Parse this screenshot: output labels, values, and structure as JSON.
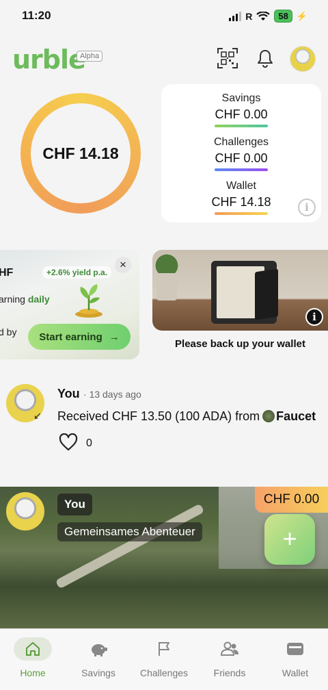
{
  "status": {
    "time": "11:20",
    "network": "R",
    "battery": "58"
  },
  "header": {
    "logo": "urble",
    "badge": "Alpha"
  },
  "balance": {
    "total": "CHF 14.18"
  },
  "summary": {
    "items": [
      {
        "label": "Savings",
        "value": "CHF 0.00",
        "color": "#7ccf6a"
      },
      {
        "label": "Challenges",
        "value": "CHF 0.00",
        "color": "#7b5cf2"
      },
      {
        "label": "Wallet",
        "value": "CHF 14.18",
        "color": "#f5b84f"
      }
    ]
  },
  "earn_card": {
    "title": "HF",
    "yield": "+2.6% yield p.a.",
    "line1_prefix": "arning",
    "line1_emph": "daily",
    "line2": "d by",
    "button": "Start earning",
    "button_arrow": "→",
    "close": "×"
  },
  "backup_card": {
    "caption": "Please back up your wallet",
    "info": "i"
  },
  "feed": {
    "author": "You",
    "separator": "·",
    "time": "13 days ago",
    "message_prefix": "Received CHF 13.50 (100 ADA) from",
    "source": "Faucet",
    "likes": "0"
  },
  "challenge": {
    "author": "You",
    "title": "Gemeinsames Abenteuer",
    "amount": "CHF 0.00",
    "add": "+"
  },
  "tabs": [
    {
      "label": "Home",
      "icon": "home-icon",
      "active": true
    },
    {
      "label": "Savings",
      "icon": "piggy-bank-icon",
      "active": false
    },
    {
      "label": "Challenges",
      "icon": "flag-icon",
      "active": false
    },
    {
      "label": "Friends",
      "icon": "people-icon",
      "active": false
    },
    {
      "label": "Wallet",
      "icon": "wallet-icon",
      "active": false
    }
  ],
  "colors": {
    "brand": "#6dbb5c",
    "accent_orange": "#f19c5a",
    "accent_yellow": "#f6ce4f"
  }
}
